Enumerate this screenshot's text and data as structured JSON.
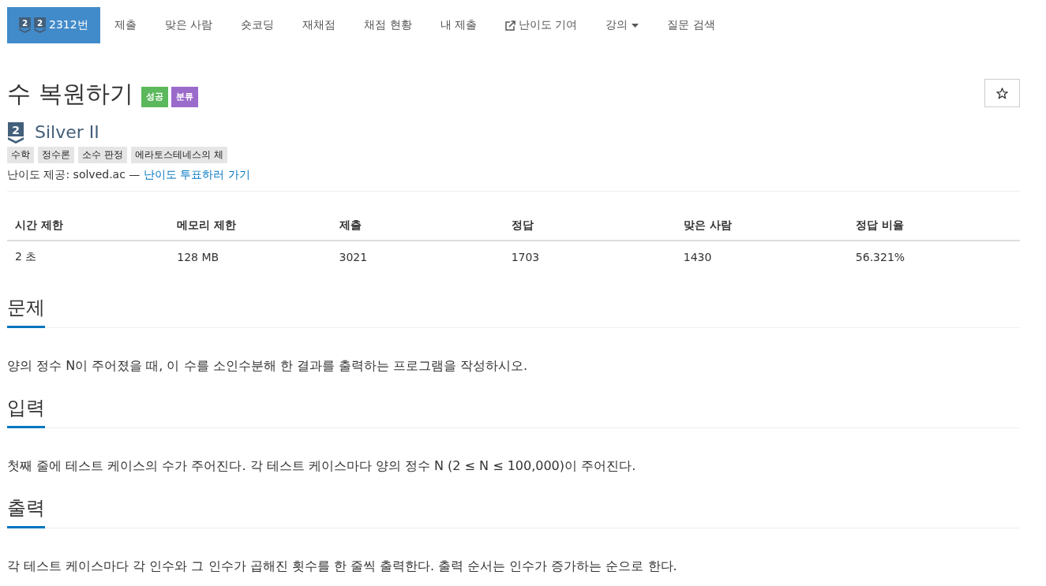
{
  "nav": {
    "items": [
      {
        "kind": "problem",
        "label": "2312번",
        "badges": [
          "2",
          "2"
        ],
        "selected": true
      },
      {
        "kind": "link",
        "label": "제출",
        "selected": false
      },
      {
        "kind": "link",
        "label": "맞은 사람",
        "selected": false
      },
      {
        "kind": "link",
        "label": "숏코딩",
        "selected": false
      },
      {
        "kind": "link",
        "label": "재채점",
        "selected": false
      },
      {
        "kind": "link",
        "label": "채점 현황",
        "selected": false
      },
      {
        "kind": "link",
        "label": "내 제출",
        "selected": false
      },
      {
        "kind": "external",
        "label": "난이도 기여",
        "selected": false
      },
      {
        "kind": "dropdown",
        "label": "강의",
        "selected": false
      },
      {
        "kind": "link",
        "label": "질문 검색",
        "selected": false
      }
    ]
  },
  "problem": {
    "title": "수 복원하기",
    "labels": [
      {
        "text": "성공",
        "color": "#5cb85c"
      },
      {
        "text": "분류",
        "color": "#9b6bcc"
      }
    ],
    "starred": false,
    "tier": {
      "badge": "2",
      "name": "Silver II"
    },
    "tags": [
      "수학",
      "정수론",
      "소수 판정",
      "에라토스테네스의 체"
    ],
    "difficulty_note": {
      "text": "난이도 제공: solved.ac —",
      "link": "난이도 투표하러 가기"
    }
  },
  "stats_table": {
    "columns": [
      "시간 제한",
      "메모리 제한",
      "제출",
      "정답",
      "맞은 사람",
      "정답 비율"
    ],
    "rows": [
      [
        "2 초",
        "128 MB",
        "3021",
        "1703",
        "1430",
        "56.321%"
      ]
    ]
  },
  "sections": [
    {
      "title": "문제",
      "body": "양의 정수 N이 주어졌을 때, 이 수를 소인수분해 한 결과를 출력하는 프로그램을 작성하시오."
    },
    {
      "title": "입력",
      "body": "첫째 줄에 테스트 케이스의 수가 주어진다. 각 테스트 케이스마다 양의 정수 N (2 ≤ N ≤ 100,000)이 주어진다."
    },
    {
      "title": "출력",
      "body": "각 테스트 케이스마다 각 인수와 그 인수가 곱해진 횟수를 한 줄씩 출력한다. 출력 순서는 인수가 증가하는 순으로 한다."
    }
  ]
}
